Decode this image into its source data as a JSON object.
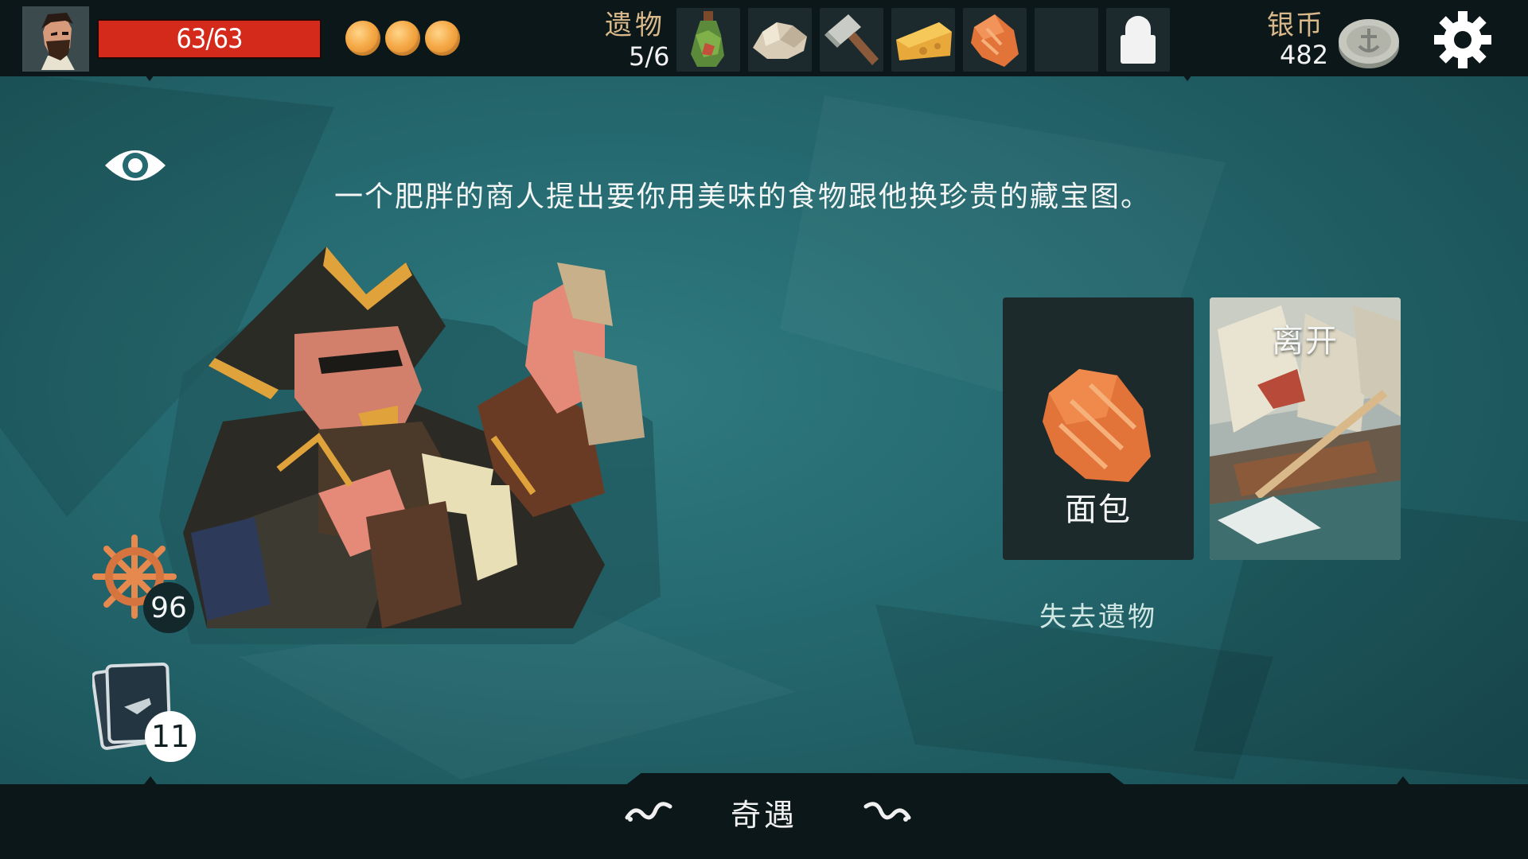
{
  "player": {
    "hp_text": "63/63",
    "hp_current": 63,
    "hp_max": 63,
    "energy_orbs": 3
  },
  "relics": {
    "label": "遗物",
    "count": "5/6",
    "items": [
      "potion-bottle-icon",
      "seashell-icon",
      "hammer-icon",
      "cheese-icon",
      "bread-icon"
    ]
  },
  "coins": {
    "label": "银币",
    "value": "482"
  },
  "encounter": {
    "description": "一个肥胖的商人提出要你用美味的食物跟他换珍贵的藏宝图。",
    "title": "奇遇"
  },
  "options": [
    {
      "label": "面包",
      "cost": "失去遗物",
      "icon": "bread-icon"
    },
    {
      "label": "离开",
      "icon": "ship-battle-art"
    }
  ],
  "stats": {
    "wheel_value": "96",
    "deck_value": "11"
  },
  "colors": {
    "hp_red": "#d42a1c",
    "background_teal": "#256a70",
    "label_gold": "#d9b98a",
    "energy_orange": "#f5a947"
  }
}
